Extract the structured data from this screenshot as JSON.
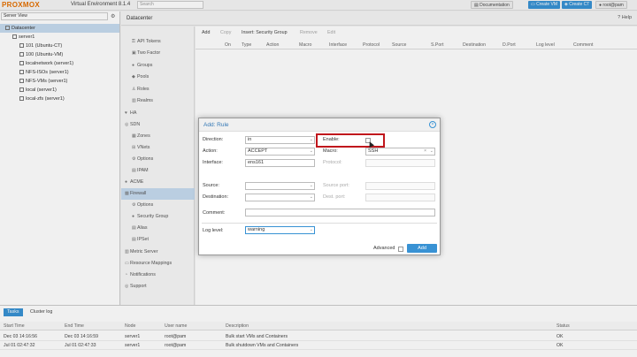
{
  "topbar": {
    "logo_pro": "PRO",
    "logo_x": "X",
    "logo_mo": "MO",
    "logo_x2": "X",
    "product": "Virtual Environment 8.1.4",
    "search_placeholder": "Search",
    "documentation": "Documentation",
    "create_vm": "Create VM",
    "create_ct": "Create CT",
    "user": "root@pam"
  },
  "tree": {
    "view": "Server View",
    "items": [
      {
        "label": "Datacenter",
        "selected": true
      },
      {
        "label": "server1",
        "selected": false
      },
      {
        "label": "101 (Ubuntu-CT)",
        "selected": false
      },
      {
        "label": "100 (Ubuntu-VM)",
        "selected": false
      },
      {
        "label": "localnetwork (server1)",
        "selected": false
      },
      {
        "label": "NFS-ISOs (server1)",
        "selected": false
      },
      {
        "label": "NFS-VMs (server1)",
        "selected": false
      },
      {
        "label": "local (server1)",
        "selected": false
      },
      {
        "label": "local-zfs (server1)",
        "selected": false
      }
    ]
  },
  "content_header": {
    "crumb": "Datacenter",
    "help": "Help"
  },
  "menu": {
    "items": [
      "API Tokens",
      "Two Factor",
      "Groups",
      "Pools",
      "Roles",
      "Realms",
      "HA",
      "SDN",
      "Zones",
      "VNets",
      "Options",
      "IPAM",
      "ACME",
      "Firewall",
      "Options",
      "Security Group",
      "Alias",
      "IPSet",
      "Metric Server",
      "Resource Mappings",
      "Notifications",
      "Support"
    ]
  },
  "grid": {
    "toolbar": [
      "Add",
      "Copy",
      "Insert: Security Group",
      "Remove",
      "Edit"
    ],
    "columns": [
      "On",
      "Type",
      "Action",
      "Macro",
      "Interface",
      "Protocol",
      "Source",
      "S.Port",
      "Destination",
      "D.Port",
      "Log level",
      "Comment"
    ]
  },
  "tasks": {
    "tabs": [
      "Tasks",
      "Cluster log"
    ],
    "columns": [
      "Start Time",
      "End Time",
      "Node",
      "User name",
      "Description",
      "Status"
    ],
    "rows": [
      {
        "start": "Dec 03 14:16:56",
        "end": "Dec 03 14:16:59",
        "node": "server1",
        "user": "root@pam",
        "desc": "Bulk start VMs and Containers",
        "status": "OK"
      },
      {
        "start": "Jul 01 02:47:32",
        "end": "Jul 01 02:47:33",
        "node": "server1",
        "user": "root@pam",
        "desc": "Bulk shutdown VMs and Containers",
        "status": "OK"
      }
    ]
  },
  "dialog": {
    "title": "Add: Rule",
    "direction_label": "Direction:",
    "direction_value": "in",
    "action_label": "Action:",
    "action_value": "ACCEPT",
    "interface_label": "Interface:",
    "interface_value": "ens161",
    "enable_label": "Enable:",
    "macro_label": "Macro:",
    "macro_value": "SSH",
    "protocol_label": "Protocol:",
    "source_label": "Source:",
    "destination_label": "Destination:",
    "sport_label": "Source port:",
    "dport_label": "Dest. port:",
    "comment_label": "Comment:",
    "loglevel_label": "Log level:",
    "loglevel_value": "warning",
    "advanced_label": "Advanced",
    "add_button": "Add"
  }
}
